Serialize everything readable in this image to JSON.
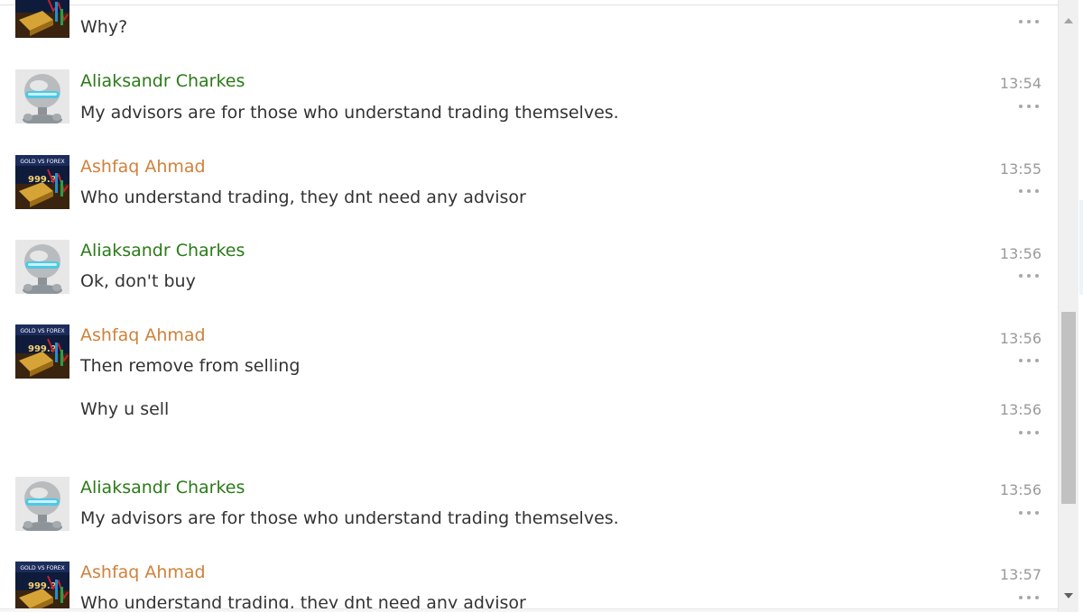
{
  "messages": [
    {
      "kind": "tail",
      "author": "",
      "text": "Why?",
      "time": ""
    },
    {
      "author": "Aliaksandr Charkes",
      "author_color": "#2b7a18",
      "avatar": "robot-avatar",
      "text": "My advisors are for those who understand trading themselves.",
      "time": "13:54"
    },
    {
      "author": "Ashfaq Ahmad",
      "author_color": "#d0813a",
      "avatar": "gold-vs-forex-avatar",
      "avatar_label": "GOLD VS FOREX",
      "text": "Who understand trading, they dnt need any advisor",
      "time": "13:55"
    },
    {
      "author": "Aliaksandr Charkes",
      "author_color": "#2b7a18",
      "avatar": "robot-avatar",
      "text": "Ok, don't buy",
      "time": "13:56"
    },
    {
      "author": "Ashfaq Ahmad",
      "author_color": "#d0813a",
      "avatar": "gold-vs-forex-avatar",
      "avatar_label": "GOLD VS FOREX",
      "text": "Then remove from selling",
      "time": "13:56"
    },
    {
      "kind": "continuation",
      "text": "Why u sell",
      "time": "13:56"
    },
    {
      "author": "Aliaksandr Charkes",
      "author_color": "#2b7a18",
      "avatar": "robot-avatar",
      "text": "My advisors are for those who understand trading themselves.",
      "time": "13:56"
    },
    {
      "author": "Ashfaq Ahmad",
      "author_color": "#d0813a",
      "avatar": "gold-vs-forex-avatar",
      "avatar_label": "GOLD VS FOREX",
      "text": "Who understand trading, they dnt need any advisor",
      "time": "13:57"
    }
  ],
  "icons": {
    "more": "more-options-icon",
    "scroll_up": "scroll-up-arrow-icon",
    "scroll_down": "scroll-down-arrow-icon"
  },
  "scrollbar": {
    "thumb_position_fraction": 0.55
  }
}
